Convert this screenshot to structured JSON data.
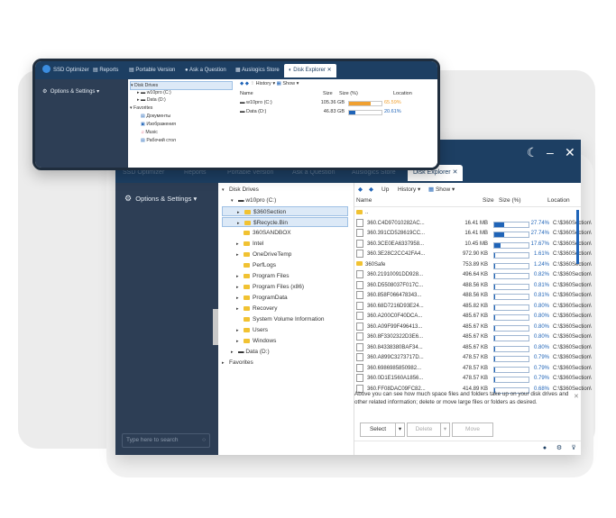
{
  "big_window": {
    "tabs": [
      "SSD Optimizer",
      "Reports",
      "Portable Version",
      "Ask a Question",
      "Auslogics Store",
      "Disk Explorer"
    ],
    "sidebar": {
      "options_label": "Options & Settings",
      "search_placeholder": "Type here to search"
    },
    "tree": {
      "disk_drives": "Disk Drives",
      "drive_c": "w10pro (C:)",
      "folders": [
        "$360Section",
        "$Recycle.Bin",
        "360SANDBOX",
        "Intel",
        "OneDriveTemp",
        "PerfLogs",
        "Program Files",
        "Program Files (x86)",
        "ProgramData",
        "Recovery",
        "System Volume Information",
        "Users",
        "Windows"
      ],
      "drive_d": "Data (D:)",
      "favorites": "Favorites"
    },
    "toolbar": {
      "up": "Up",
      "history": "History",
      "show": "Show"
    },
    "columns": {
      "name": "Name",
      "size": "Size",
      "size_pct": "Size (%)",
      "location": "Location"
    },
    "rows": [
      {
        "name": "..",
        "size": "",
        "pct": "",
        "fill": 0,
        "loc": "",
        "type": "folder"
      },
      {
        "name": "360.C4D97010282AC...",
        "size": "16.41 MB",
        "pct": "27.74%",
        "fill": 0.2774,
        "loc": "C:\\$360Section\\",
        "type": "file"
      },
      {
        "name": "360.391CD528619CC...",
        "size": "16.41 MB",
        "pct": "27.74%",
        "fill": 0.2774,
        "loc": "C:\\$360Section\\",
        "type": "file"
      },
      {
        "name": "360.3CE0EA6337958...",
        "size": "10.45 MB",
        "pct": "17.67%",
        "fill": 0.1767,
        "loc": "C:\\$360Section\\",
        "type": "file"
      },
      {
        "name": "360.3E28C2CC42FA4...",
        "size": "972.90 KB",
        "pct": "1.61%",
        "fill": 0.0161,
        "loc": "C:\\$360Section\\",
        "type": "file"
      },
      {
        "name": "360Safe",
        "size": "753.89 KB",
        "pct": "1.24%",
        "fill": 0.0124,
        "loc": "C:\\$360Section\\",
        "type": "folder"
      },
      {
        "name": "360.21910091DD928...",
        "size": "496.64 KB",
        "pct": "0.82%",
        "fill": 0.0082,
        "loc": "C:\\$360Section\\",
        "type": "file"
      },
      {
        "name": "360.D5508037F017C...",
        "size": "488.56 KB",
        "pct": "0.81%",
        "fill": 0.0081,
        "loc": "C:\\$360Section\\",
        "type": "file"
      },
      {
        "name": "360.858F066478343...",
        "size": "488.56 KB",
        "pct": "0.81%",
        "fill": 0.0081,
        "loc": "C:\\$360Section\\",
        "type": "file"
      },
      {
        "name": "360.68D7216D93E24...",
        "size": "485.82 KB",
        "pct": "0.80%",
        "fill": 0.008,
        "loc": "C:\\$360Section\\",
        "type": "file"
      },
      {
        "name": "360.A200C0F40DCA...",
        "size": "485.67 KB",
        "pct": "0.80%",
        "fill": 0.008,
        "loc": "C:\\$360Section\\",
        "type": "file"
      },
      {
        "name": "360.A09F99F496413...",
        "size": "485.67 KB",
        "pct": "0.80%",
        "fill": 0.008,
        "loc": "C:\\$360Section\\",
        "type": "file"
      },
      {
        "name": "360.8F3302322D3E6...",
        "size": "485.67 KB",
        "pct": "0.80%",
        "fill": 0.008,
        "loc": "C:\\$360Section\\",
        "type": "file"
      },
      {
        "name": "360.84338380BAF34...",
        "size": "485.67 KB",
        "pct": "0.80%",
        "fill": 0.008,
        "loc": "C:\\$360Section\\",
        "type": "file"
      },
      {
        "name": "360.A899C3273717D...",
        "size": "478.57 KB",
        "pct": "0.79%",
        "fill": 0.0079,
        "loc": "C:\\$360Section\\",
        "type": "file"
      },
      {
        "name": "360.6986985850982...",
        "size": "478.57 KB",
        "pct": "0.79%",
        "fill": 0.0079,
        "loc": "C:\\$360Section\\",
        "type": "file"
      },
      {
        "name": "360.0D1E1560A1856...",
        "size": "478.57 KB",
        "pct": "0.79%",
        "fill": 0.0079,
        "loc": "C:\\$360Section\\",
        "type": "file"
      },
      {
        "name": "360.FF08DAC09FC82...",
        "size": "414.89 KB",
        "pct": "0.68%",
        "fill": 0.0068,
        "loc": "C:\\$360Section\\",
        "type": "file"
      }
    ],
    "info": "Above you can see how much space files and folders take up on your disk drives and other related information; delete or move large files or folders as desired.",
    "buttons": {
      "select": "Select",
      "delete": "Delete",
      "move": "Move"
    }
  },
  "small_window": {
    "tabs": [
      "SSD Optimizer",
      "Reports",
      "Portable Version",
      "Ask a Question",
      "Auslogics Store",
      "Disk Explorer"
    ],
    "options_label": "Options & Settings",
    "tree": {
      "disk_drives": "Disk Drives",
      "drive_c": "w10pro (C:)",
      "drive_d": "Data (D:)",
      "favorites": "Favorites",
      "fav_items": [
        "Документы",
        "Изображения",
        "Music",
        "Рабочий стол"
      ]
    },
    "toolbar": {
      "history": "History",
      "show": "Show"
    },
    "columns": {
      "name": "Name",
      "size": "Size",
      "size_pct": "Size (%)",
      "location": "Location"
    },
    "rows": [
      {
        "name": "w10pro (C:)",
        "size": "105.36 GB",
        "pct": "65.59%",
        "fill": 0.6559,
        "color": "#f0a030"
      },
      {
        "name": "Data (D:)",
        "size": "46.83 GB",
        "pct": "20.61%",
        "fill": 0.2061,
        "color": "#1f64b8"
      }
    ]
  },
  "colors": {
    "title_bar": "#1d3f63",
    "sidebar": "#2d3e55",
    "accent": "#1f64b8",
    "selection": "#dce9f7"
  }
}
